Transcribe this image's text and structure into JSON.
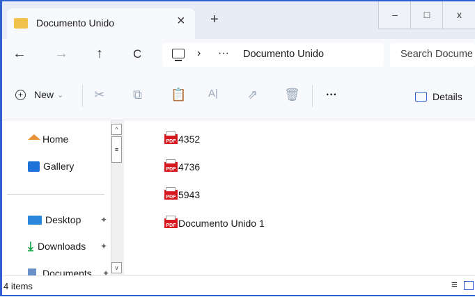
{
  "window": {
    "tab_title": "Documento Unido",
    "close_tab_glyph": "×",
    "new_tab_glyph": "+",
    "minimize_glyph": "–",
    "maximize_glyph": "□",
    "close_glyph": "x"
  },
  "address": {
    "back_glyph": "←",
    "forward_glyph": "→",
    "up_glyph": "↑",
    "refresh_glyph": "C",
    "separator": "›",
    "ellipsis": "···",
    "current_folder": "Documento Unido",
    "search_placeholder": "Search Docume"
  },
  "toolbar": {
    "new_label": "New",
    "new_chevron": "⌄",
    "more_label": "···",
    "details_label": "Details"
  },
  "sidebar": {
    "items": [
      {
        "label": "Home",
        "icon": "home-icon"
      },
      {
        "label": "Gallery",
        "icon": "gallery-icon"
      },
      {
        "label": "Desktop",
        "icon": "desktop-icon",
        "pinned": true
      },
      {
        "label": "Downloads",
        "icon": "downloads-icon",
        "pinned": true
      },
      {
        "label": "Documents",
        "icon": "documents-icon",
        "pinned": true
      }
    ],
    "pin_glyph": "📌"
  },
  "files": [
    {
      "name": "4352",
      "type": "pdf"
    },
    {
      "name": "4736",
      "type": "pdf"
    },
    {
      "name": "5943",
      "type": "pdf"
    },
    {
      "name": "Documento Unido 1",
      "type": "pdf"
    }
  ],
  "pdf_badge": "PDF",
  "status": {
    "count": "4 items"
  },
  "colors": {
    "accent": "#2f5fd0",
    "pdf_red": "#d71920",
    "folder_yellow": "#f2c14b"
  }
}
